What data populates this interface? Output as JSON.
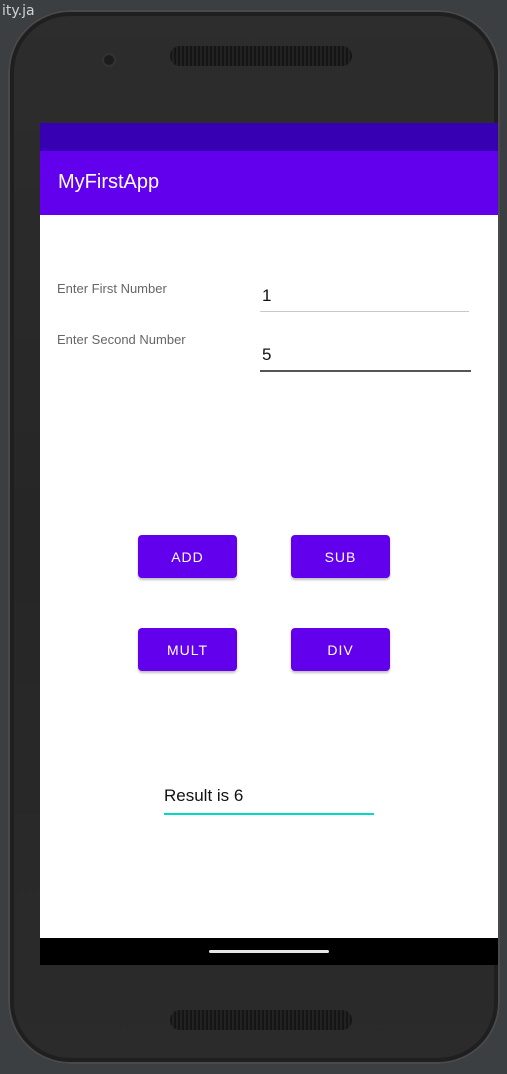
{
  "ide": {
    "fragment": "ity.ja"
  },
  "app": {
    "title": "MyFirstApp",
    "colors": {
      "primary": "#6200ee",
      "primary_dark": "#3700b3",
      "accent": "#03dac5"
    }
  },
  "form": {
    "first_label": "Enter First Number",
    "first_value": "1",
    "second_label": "Enter Second Number",
    "second_value": "5"
  },
  "buttons": {
    "add": "ADD",
    "sub": "SUB",
    "mult": "MULT",
    "div": "DIV"
  },
  "result": {
    "value": "Result is 6"
  }
}
